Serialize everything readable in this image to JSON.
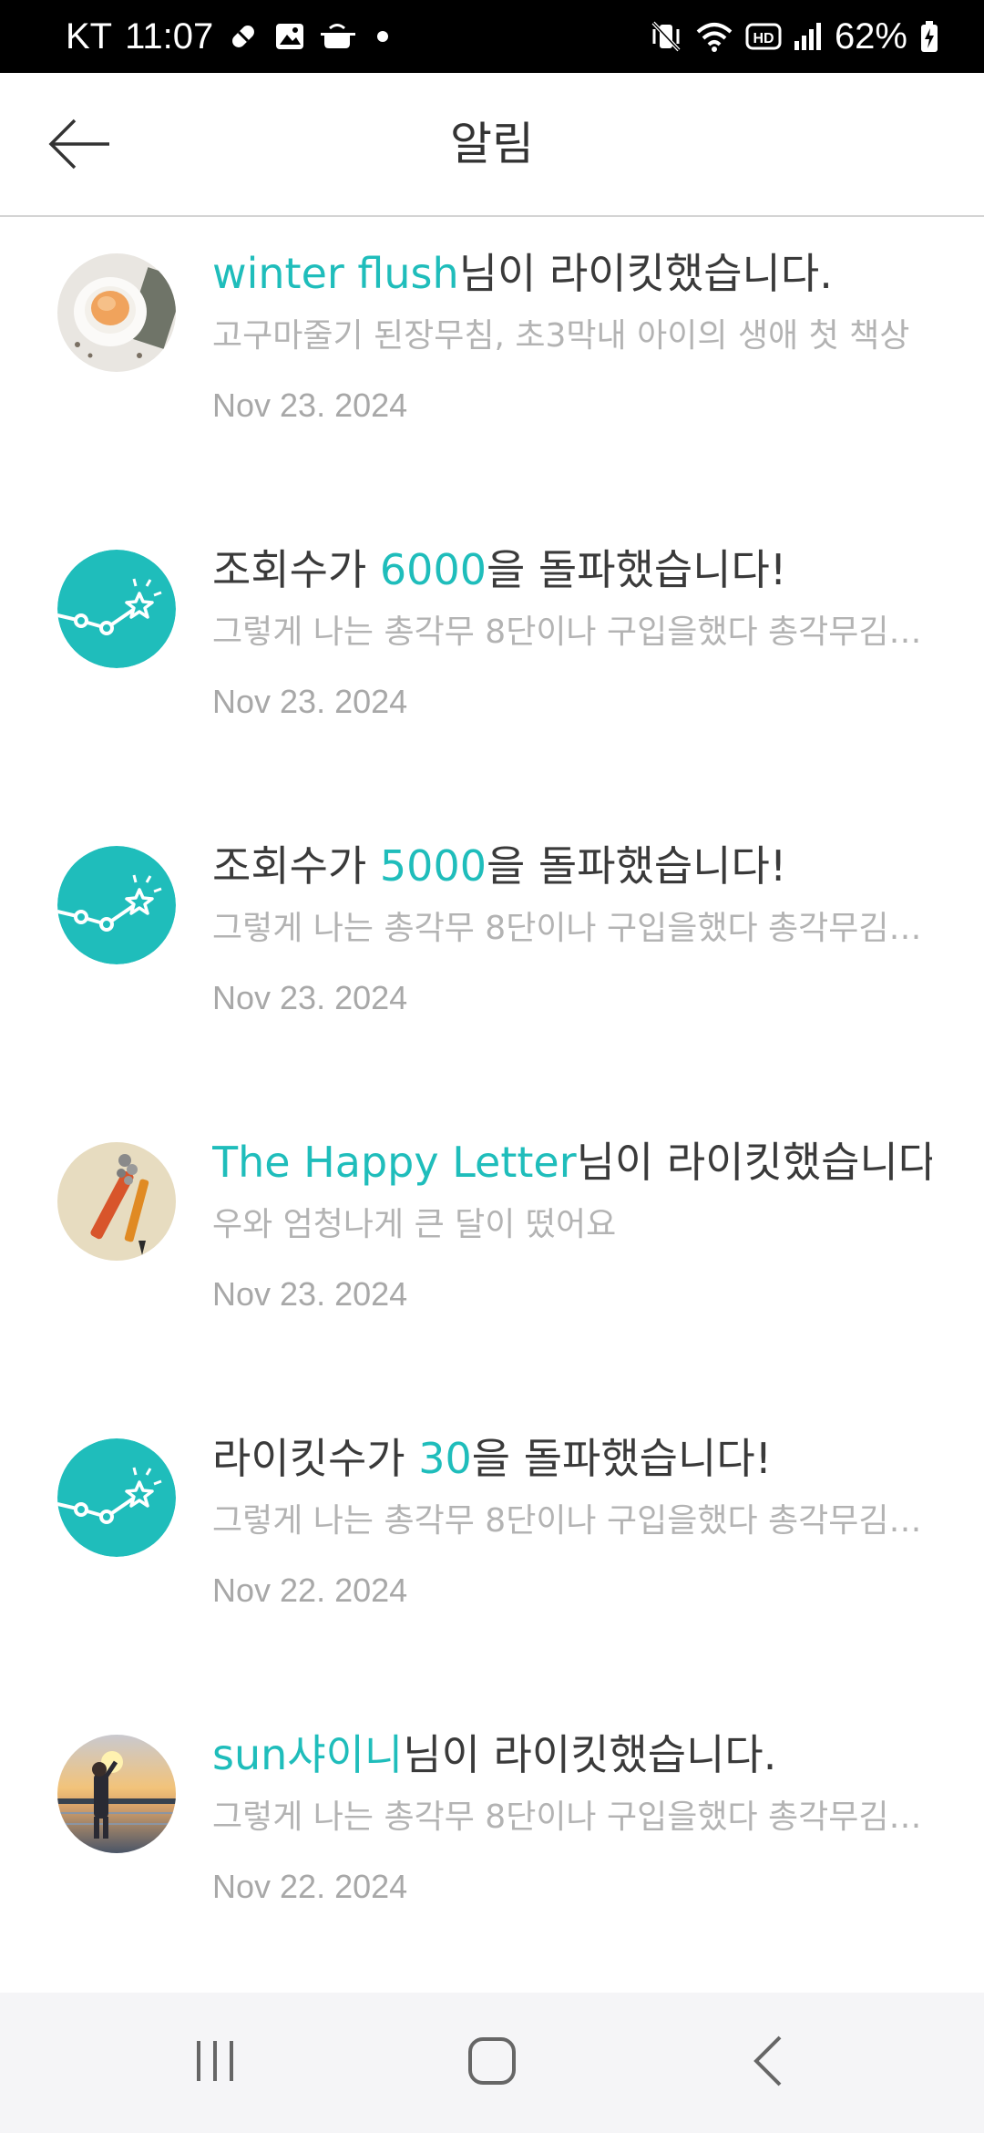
{
  "status_bar": {
    "carrier": "KT",
    "time": "11:07",
    "battery": "62%"
  },
  "header": {
    "title": "알림"
  },
  "notifications": [
    {
      "avatar": "tea-cup-photo",
      "title_accent": "winter flush",
      "title_rest": "님이 라이킷했습니다.",
      "excerpt": "고구마줄기 된장무침, 초3막내 아이의 생애 첫 책상",
      "date": "Nov 23. 2024"
    },
    {
      "avatar": "milestone-chart-icon",
      "title_prefix": "조회수가 ",
      "title_accent": "6000",
      "title_rest": "을 돌파했습니다!",
      "excerpt": "그렇게 나는 총각무 8단이나 구입을했다 총각무김…",
      "date": "Nov 23. 2024"
    },
    {
      "avatar": "milestone-chart-icon",
      "title_prefix": "조회수가 ",
      "title_accent": "5000",
      "title_rest": "을 돌파했습니다!",
      "excerpt": "그렇게 나는 총각무 8단이나 구입을했다 총각무김…",
      "date": "Nov 23. 2024"
    },
    {
      "avatar": "pencil-photo",
      "title_accent": "The Happy Letter",
      "title_rest": "님이 라이킷했습니다.",
      "excerpt": "우와 엄청나게 큰 달이 떴어요",
      "date": "Nov 23. 2024"
    },
    {
      "avatar": "milestone-chart-icon",
      "title_prefix": "라이킷수가 ",
      "title_accent": "30",
      "title_rest": "을 돌파했습니다!",
      "excerpt": "그렇게 나는 총각무 8단이나 구입을했다 총각무김…",
      "date": "Nov 22. 2024"
    },
    {
      "avatar": "sunset-person-photo",
      "title_accent": "sun샤이니",
      "title_rest": "님이 라이킷했습니다.",
      "excerpt": "그렇게 나는 총각무 8단이나 구입을했다 총각무김…",
      "date": "Nov 22. 2024"
    }
  ],
  "colors": {
    "accent": "#1fbdbb",
    "title_text": "#3a3a3a",
    "secondary_text": "#b3b3b3"
  }
}
